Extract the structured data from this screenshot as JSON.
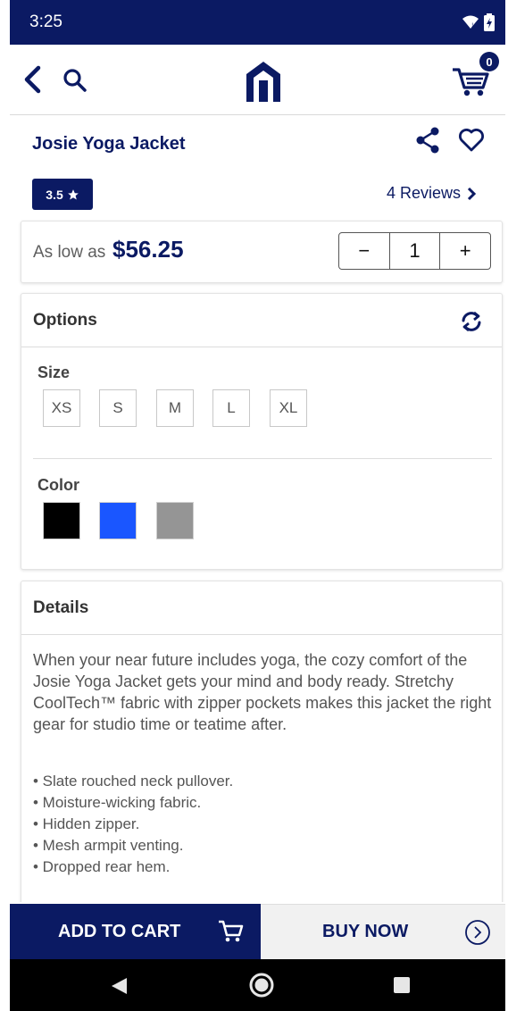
{
  "status_bar": {
    "time": "3:25",
    "wifi_icon": "wifi-icon",
    "battery_icon": "battery-charging-icon"
  },
  "app_bar": {
    "back_icon": "back-arrow-icon",
    "search_icon": "search-icon",
    "logo_icon": "store-logo-icon",
    "cart_icon": "cart-icon",
    "cart_count": "0"
  },
  "product": {
    "title": "Josie Yoga Jacket",
    "rating": "3.5",
    "reviews_label": "4 Reviews",
    "price_label": "As low as",
    "price": "$56.25",
    "quantity": "1",
    "decrement_label": "−",
    "increment_label": "+"
  },
  "options": {
    "title": "Options",
    "size_label": "Size",
    "sizes": [
      "XS",
      "S",
      "M",
      "L",
      "XL"
    ],
    "color_label": "Color",
    "colors": [
      "#000000",
      "#1a56ff",
      "#959595"
    ]
  },
  "details": {
    "title": "Details",
    "text": "When your near future includes yoga, the cozy comfort of the Josie Yoga Jacket gets your mind and body ready. Stretchy CoolTech™ fabric with zipper pockets makes this jacket the right gear for studio time or teatime after.",
    "bullets": [
      "• Slate rouched neck pullover.",
      "• Moisture-wicking fabric.",
      "• Hidden zipper.",
      "• Mesh armpit venting.",
      "• Dropped rear hem."
    ]
  },
  "bottom_bar": {
    "add_to_cart": "ADD TO CART",
    "buy_now": "BUY NOW"
  },
  "colors": {
    "brand": "#0b1a63",
    "nav_bg": "#000000"
  }
}
